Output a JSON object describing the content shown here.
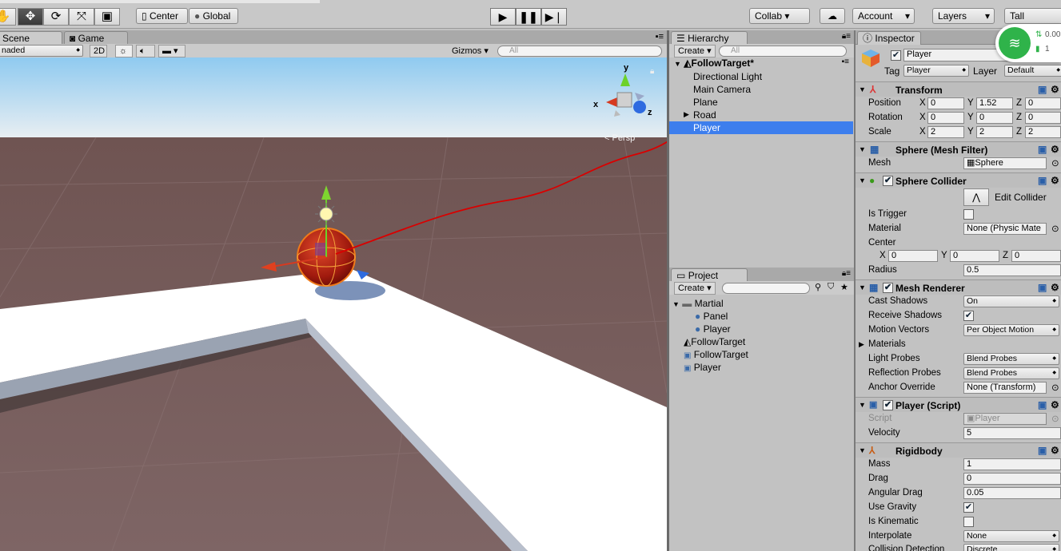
{
  "toolbar": {
    "pivot_label": "Center",
    "space_label": "Global",
    "collab_label": "Collab ▾",
    "account_label": "Account",
    "layers_label": "Layers",
    "layout_label": "Tall"
  },
  "scene": {
    "tab_scene": "Scene",
    "tab_game": "Game",
    "shading_mode": "naded",
    "mode_2d": "2D",
    "gizmos_label": "Gizmos",
    "search_placeholder": "All",
    "persp_label": "< Persp",
    "axis_x": "x",
    "axis_y": "y",
    "axis_z": "z"
  },
  "hierarchy": {
    "title": "Hierarchy",
    "create_label": "Create",
    "search_placeholder": "All",
    "scene_name": "FollowTarget*",
    "items": [
      "Directional Light",
      "Main Camera",
      "Plane",
      "Road",
      "Player"
    ],
    "selected": "Player"
  },
  "project": {
    "title": "Project",
    "create_label": "Create",
    "items": [
      {
        "label": "Martial",
        "icon": "folder-icon"
      },
      {
        "label": "Panel",
        "icon": "material-sphere-icon"
      },
      {
        "label": "Player",
        "icon": "material-sphere-icon"
      },
      {
        "label": "FollowTarget",
        "icon": "unity-scene-icon"
      },
      {
        "label": "FollowTarget",
        "icon": "csharp-script-icon"
      },
      {
        "label": "Player",
        "icon": "csharp-script-icon"
      }
    ]
  },
  "inspector": {
    "title": "Inspector",
    "object_name": "Player",
    "tag_label": "Tag",
    "tag_value": "Player",
    "layer_label": "Layer",
    "layer_value": "Default",
    "transform": {
      "title": "Transform",
      "position_label": "Position",
      "pos_x": "0",
      "pos_y": "1.52",
      "pos_z": "0",
      "rotation_label": "Rotation",
      "rot_x": "0",
      "rot_y": "0",
      "rot_z": "0",
      "scale_label": "Scale",
      "scale_x": "2",
      "scale_y": "2",
      "scale_z": "2",
      "x": "X",
      "y": "Y",
      "z": "Z"
    },
    "mesh_filter": {
      "title": "Sphere (Mesh Filter)",
      "mesh_label": "Mesh",
      "mesh_value": "Sphere"
    },
    "collider": {
      "title": "Sphere Collider",
      "edit_label": "Edit Collider",
      "trigger_label": "Is Trigger",
      "material_label": "Material",
      "material_value": "None (Physic Mate",
      "center_label": "Center",
      "center_x": "0",
      "center_y": "0",
      "center_z": "0",
      "radius_label": "Radius",
      "radius_value": "0.5"
    },
    "renderer": {
      "title": "Mesh Renderer",
      "cast_label": "Cast Shadows",
      "cast_value": "On",
      "receive_label": "Receive Shadows",
      "motion_label": "Motion Vectors",
      "motion_value": "Per Object Motion",
      "materials_label": "Materials",
      "light_label": "Light Probes",
      "light_value": "Blend Probes",
      "reflection_label": "Reflection Probes",
      "reflection_value": "Blend Probes",
      "anchor_label": "Anchor Override",
      "anchor_value": "None (Transform)"
    },
    "script": {
      "title": "Player (Script)",
      "script_label": "Script",
      "script_value": "Player",
      "velocity_label": "Velocity",
      "velocity_value": "5"
    },
    "rigidbody": {
      "title": "Rigidbody",
      "mass_label": "Mass",
      "mass_value": "1",
      "drag_label": "Drag",
      "drag_value": "0",
      "angular_label": "Angular Drag",
      "angular_value": "0.05",
      "gravity_label": "Use Gravity",
      "kinematic_label": "Is Kinematic",
      "interpolate_label": "Interpolate",
      "interpolate_value": "None",
      "collision_label": "Collision Detection",
      "collision_value": "Discrete"
    }
  },
  "overlay": {
    "net_speed": "0.00",
    "net_count": "1"
  },
  "colors": {
    "selection": "#3d7eed",
    "annotation_arrow": "#d90000"
  }
}
